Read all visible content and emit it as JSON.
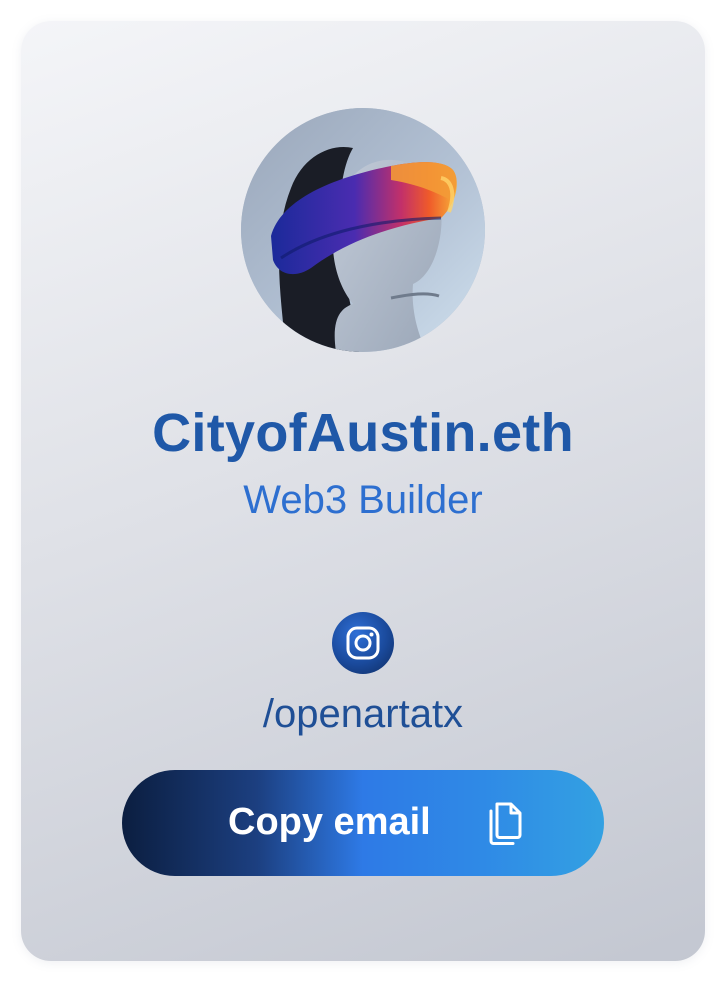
{
  "profile": {
    "name": "CityofAustin.eth",
    "role": "Web3 Builder",
    "avatar_icon": "vr-headset-avatar"
  },
  "social": {
    "instagram_icon": "instagram-icon",
    "handle": "/openartatx"
  },
  "actions": {
    "copy_email_label": "Copy email",
    "copy_icon": "copy-document-icon"
  },
  "colors": {
    "name": "#1f58a8",
    "role": "#2d6fd0",
    "handle": "#1f4f96",
    "button_start": "#0b1e40",
    "button_mid": "#2e7ae6",
    "button_end": "#33a1e2"
  }
}
